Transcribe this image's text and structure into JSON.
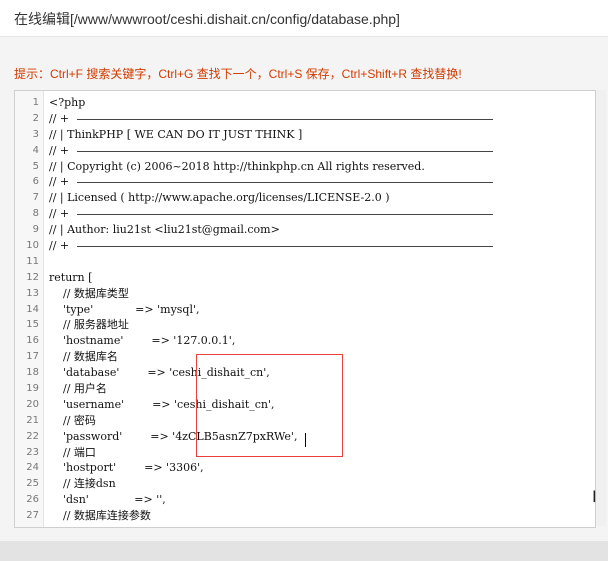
{
  "window": {
    "title": "在线编辑[/www/wwwroot/ceshi.dishait.cn/config/database.php]"
  },
  "hint": "提示：Ctrl+F 搜索关键字，Ctrl+G 查找下一个，Ctrl+S 保存，Ctrl+Shift+R 查找替换!",
  "code_lines": [
    {
      "n": "1",
      "text": "<?php"
    },
    {
      "n": "2",
      "text": "// +",
      "rule": true
    },
    {
      "n": "3",
      "text": "// | ThinkPHP [ WE CAN DO IT JUST THINK ]"
    },
    {
      "n": "4",
      "text": "// +",
      "rule": true
    },
    {
      "n": "5",
      "text": "// | Copyright (c) 2006~2018 http://thinkphp.cn All rights reserved."
    },
    {
      "n": "6",
      "text": "// +",
      "rule": true
    },
    {
      "n": "7",
      "text": "// | Licensed ( http://www.apache.org/licenses/LICENSE-2.0 )"
    },
    {
      "n": "8",
      "text": "// +",
      "rule": true
    },
    {
      "n": "9",
      "text": "// | Author: liu21st <liu21st@gmail.com>"
    },
    {
      "n": "10",
      "text": "// +",
      "rule": true
    },
    {
      "n": "11",
      "text": ""
    },
    {
      "n": "12",
      "text": "return ["
    },
    {
      "n": "13",
      "text": "    // 数据库类型"
    },
    {
      "n": "14",
      "text": "    'type'            => 'mysql',"
    },
    {
      "n": "15",
      "text": "    // 服务器地址"
    },
    {
      "n": "16",
      "text": "    'hostname'        => '127.0.0.1',"
    },
    {
      "n": "17",
      "text": "    // 数据库名"
    },
    {
      "n": "18",
      "text": "    'database'        => 'ceshi_dishait_cn',"
    },
    {
      "n": "19",
      "text": "    // 用户名"
    },
    {
      "n": "20",
      "text": "    'username'        => 'ceshi_dishait_cn',"
    },
    {
      "n": "21",
      "text": "    // 密码"
    },
    {
      "n": "22",
      "text": "    'password'        => '4zCLB5asnZ7pxRWe',"
    },
    {
      "n": "23",
      "text": "    // 端口"
    },
    {
      "n": "24",
      "text": "    'hostport'        => '3306',"
    },
    {
      "n": "25",
      "text": "    // 连接dsn"
    },
    {
      "n": "26",
      "text": "    'dsn'             => '',"
    },
    {
      "n": "27",
      "text": "    // 数据库连接参数"
    }
  ],
  "colors": {
    "hint": "#d23b00",
    "highlight_box": "#e8433a"
  },
  "icons": {
    "cursor": "text-cursor-icon"
  }
}
